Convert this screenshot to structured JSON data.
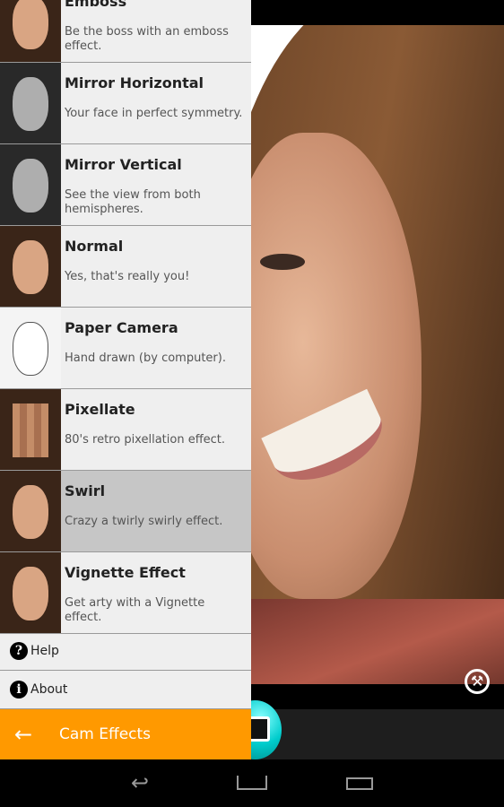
{
  "effects": [
    {
      "title": "Emboss",
      "desc": "Be the boss with an emboss effect.",
      "style": "normal"
    },
    {
      "title": "Mirror Horizontal",
      "desc": "Your face in perfect symmetry.",
      "style": "gray"
    },
    {
      "title": "Mirror Vertical",
      "desc": "See the view from both hemispheres.",
      "style": "gray"
    },
    {
      "title": "Normal",
      "desc": "Yes, that's really you!",
      "style": "normal"
    },
    {
      "title": "Paper Camera",
      "desc": "Hand drawn (by computer).",
      "style": "paper"
    },
    {
      "title": "Pixellate",
      "desc": "80's retro pixellation effect.",
      "style": "pix"
    },
    {
      "title": "Swirl",
      "desc": "Crazy a twirly swirly effect.",
      "style": "normal",
      "selected": true
    },
    {
      "title": "Vignette Effect",
      "desc": "Get arty with a Vignette effect.",
      "style": "normal"
    }
  ],
  "menu": {
    "help": "Help",
    "about": "About"
  },
  "action_bar": {
    "title": "Cam Effects"
  },
  "colors": {
    "accent": "#ff9900",
    "selected": "#c6c6c6",
    "shutter": "#00cccc"
  }
}
